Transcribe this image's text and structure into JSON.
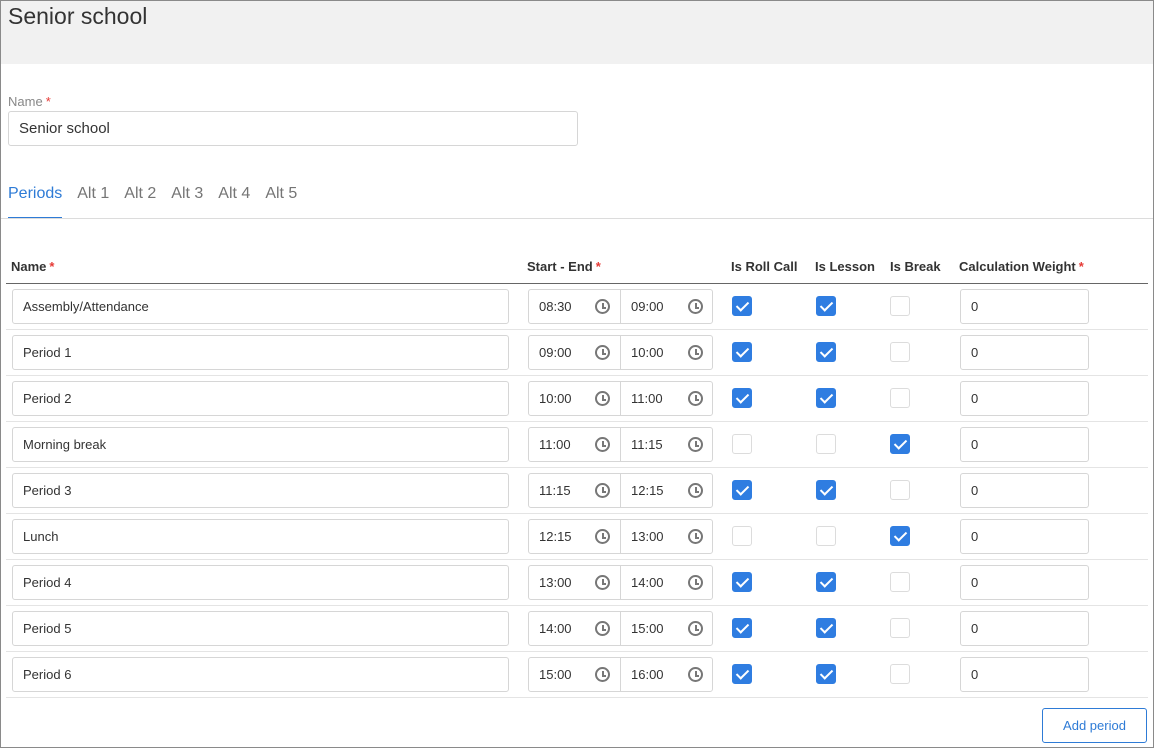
{
  "header": {
    "title": "Senior school"
  },
  "name_field": {
    "label": "Name",
    "required_mark": "*",
    "value": "Senior school"
  },
  "tabs": [
    {
      "label": "Periods",
      "active": true
    },
    {
      "label": "Alt 1",
      "active": false
    },
    {
      "label": "Alt 2",
      "active": false
    },
    {
      "label": "Alt 3",
      "active": false
    },
    {
      "label": "Alt 4",
      "active": false
    },
    {
      "label": "Alt 5",
      "active": false
    }
  ],
  "table": {
    "columns": {
      "name": "Name",
      "start_end": "Start - End",
      "is_roll_call": "Is Roll Call",
      "is_lesson": "Is Lesson",
      "is_break": "Is Break",
      "calculation_weight": "Calculation Weight"
    },
    "required_mark": "*",
    "rows": [
      {
        "name": "Assembly/Attendance",
        "start": "08:30",
        "end": "09:00",
        "roll_call": true,
        "lesson": true,
        "break": false,
        "weight": "0"
      },
      {
        "name": "Period 1",
        "start": "09:00",
        "end": "10:00",
        "roll_call": true,
        "lesson": true,
        "break": false,
        "weight": "0"
      },
      {
        "name": "Period 2",
        "start": "10:00",
        "end": "11:00",
        "roll_call": true,
        "lesson": true,
        "break": false,
        "weight": "0"
      },
      {
        "name": "Morning break",
        "start": "11:00",
        "end": "11:15",
        "roll_call": false,
        "lesson": false,
        "break": true,
        "weight": "0"
      },
      {
        "name": "Period 3",
        "start": "11:15",
        "end": "12:15",
        "roll_call": true,
        "lesson": true,
        "break": false,
        "weight": "0"
      },
      {
        "name": "Lunch",
        "start": "12:15",
        "end": "13:00",
        "roll_call": false,
        "lesson": false,
        "break": true,
        "weight": "0"
      },
      {
        "name": "Period 4",
        "start": "13:00",
        "end": "14:00",
        "roll_call": true,
        "lesson": true,
        "break": false,
        "weight": "0"
      },
      {
        "name": "Period 5",
        "start": "14:00",
        "end": "15:00",
        "roll_call": true,
        "lesson": true,
        "break": false,
        "weight": "0"
      },
      {
        "name": "Period 6",
        "start": "15:00",
        "end": "16:00",
        "roll_call": true,
        "lesson": true,
        "break": false,
        "weight": "0"
      }
    ]
  },
  "actions": {
    "add_period_label": "Add period"
  },
  "colors": {
    "accent": "#2e7bd6",
    "checkbox": "#2f7de1",
    "required": "#e53935",
    "header_bg": "#f1f1f1"
  },
  "icons": {
    "time": "clock-icon"
  }
}
